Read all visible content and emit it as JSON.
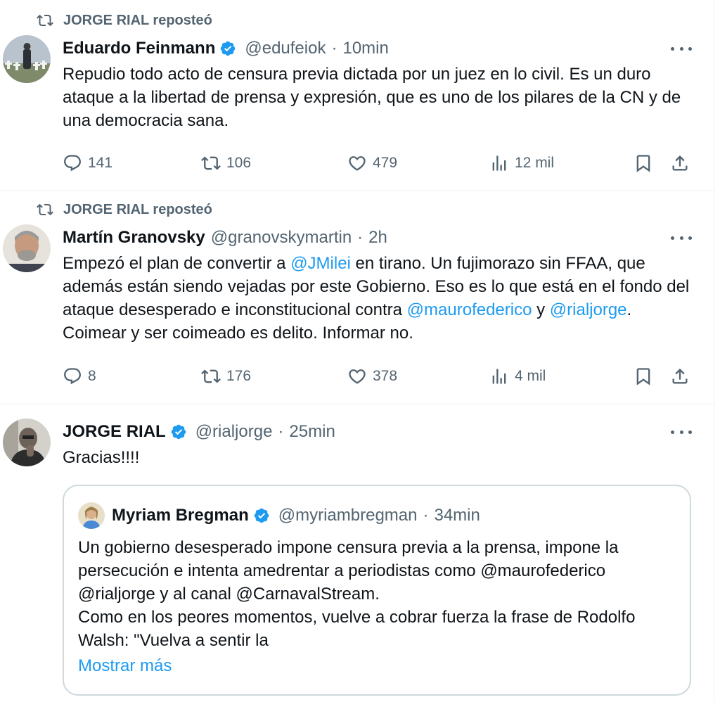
{
  "colors": {
    "accent": "#1d9bf0",
    "muted": "#536471",
    "text": "#0f1419",
    "border": "#cfd9de"
  },
  "tweets": [
    {
      "repost_label": "JORGE RIAL reposteó",
      "name": "Eduardo Feinmann",
      "verified": true,
      "handle": "@edufeiok",
      "separator": "·",
      "time": "10min",
      "text": "Repudio todo acto de censura previa dictada por un juez en lo civil. Es un duro ataque a la libertad de prensa y expresión, que es uno de los pilares de la CN y de una democracia sana.",
      "replies": "141",
      "reposts": "106",
      "likes": "479",
      "views": "12 mil"
    },
    {
      "repost_label": "JORGE RIAL reposteó",
      "name": "Martín Granovsky",
      "verified": false,
      "handle": "@granovskymartin",
      "separator": "·",
      "time": "2h",
      "text_parts": {
        "p1": "Empezó el plan de convertir a ",
        "m1": "@JMilei",
        "p2": " en tirano. Un fujimorazo sin FFAA, que además están siendo vejadas por este Gobierno. Eso es lo que está en el fondo del ataque desesperado e inconstitucional contra ",
        "m2": "@maurofederico",
        "p3": " y ",
        "m3": "@rialjorge",
        "p4": ". Coimear y ser coimeado es delito. Informar no."
      },
      "replies": "8",
      "reposts": "176",
      "likes": "378",
      "views": "4 mil"
    },
    {
      "name": "JORGE RIAL",
      "verified": true,
      "handle": "@rialjorge",
      "separator": "·",
      "time": "25min",
      "text": "Gracias!!!!",
      "quote": {
        "name": "Myriam Bregman",
        "verified": true,
        "handle": "@myriambregman",
        "separator": "·",
        "time": "34min",
        "line1": "Un gobierno desesperado impone censura previa a la prensa, impone la persecución e intenta amedrentar a periodistas como @maurofederico @rialjorge y al canal @CarnavalStream.",
        "line2": "Como en los peores momentos, vuelve a cobrar fuerza la frase de Rodolfo Walsh: \"Vuelva a sentir la",
        "show_more": "Mostrar más"
      }
    }
  ],
  "icons": [
    "repost-icon",
    "verified-badge-icon",
    "more-icon",
    "reply-icon",
    "like-icon",
    "views-icon",
    "bookmark-icon",
    "share-icon"
  ]
}
